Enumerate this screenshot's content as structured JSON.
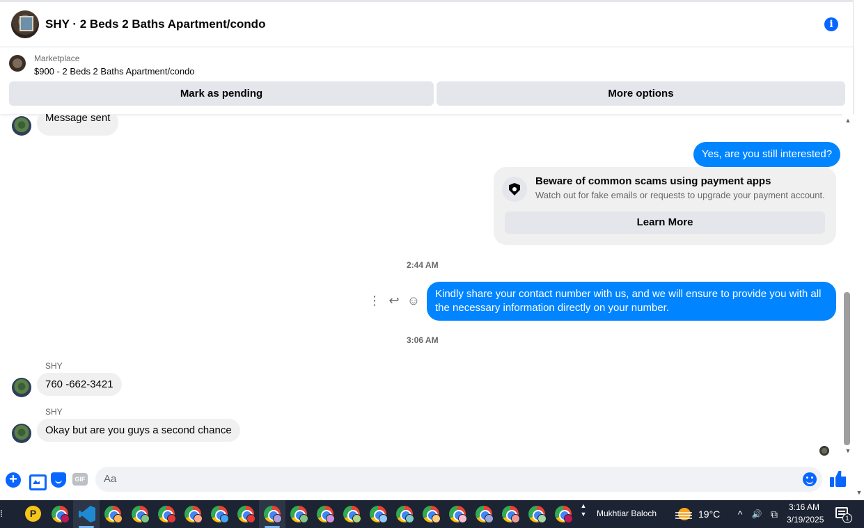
{
  "header": {
    "title": "SHY · 2 Beds 2 Baths Apartment/condo",
    "info_icon": "info-icon"
  },
  "marketplace": {
    "label": "Marketplace",
    "listing": "$900 - 2 Beds 2 Baths Apartment/condo",
    "mark_pending": "Mark as pending",
    "more_options": "More options"
  },
  "messages": {
    "first_in": "Message sent",
    "out_1": "Yes, are you still interested?",
    "scam": {
      "title": "Beware of common scams using payment apps",
      "subtitle": "Watch out for fake emails or requests to upgrade your payment account.",
      "button": "Learn More"
    },
    "time_1": "2:44 AM",
    "out_2": "Kindly share your contact number with us, and we will ensure to provide you with all the necessary information directly on your number.",
    "time_2": "3:06 AM",
    "in_1": {
      "sender": "SHY",
      "text": "760 -662-3421"
    },
    "in_2": {
      "sender": "SHY",
      "text": "Okay but are you guys a second chance"
    },
    "actions": {
      "more": "⋮",
      "reply": "↩",
      "react": "☺"
    }
  },
  "composer": {
    "placeholder": "Aa",
    "plus": "+",
    "gif": "GIF"
  },
  "taskbar": {
    "user": "Mukhtiar Baloch",
    "temperature": "19°C",
    "time": "3:16 AM",
    "date": "3/19/2025",
    "notifications": "1",
    "tray": {
      "chevron": "^",
      "volume": "🔊",
      "meet": "⧉"
    },
    "scroll_up": "▲",
    "scroll_down": "▼",
    "yellow_app": "P",
    "badge_colors": [
      "#c2185b",
      "#e57373",
      "#ffb74d",
      "#81c784",
      "#e53935",
      "#ffab91",
      "#42a5f5",
      "#e53935",
      "#b39ddb",
      "#81c784",
      "#ce93d8",
      "#aed581",
      "#90caf9",
      "#80cbc4",
      "#ffcc80",
      "#f8bbd0",
      "#9fa8da",
      "#ef9a9a",
      "#a5d6a7"
    ]
  },
  "colors": {
    "accent": "#0866ff",
    "bubble_out": "#0084ff",
    "bubble_in": "#f0f0f0",
    "taskbar": "#1c2433"
  }
}
